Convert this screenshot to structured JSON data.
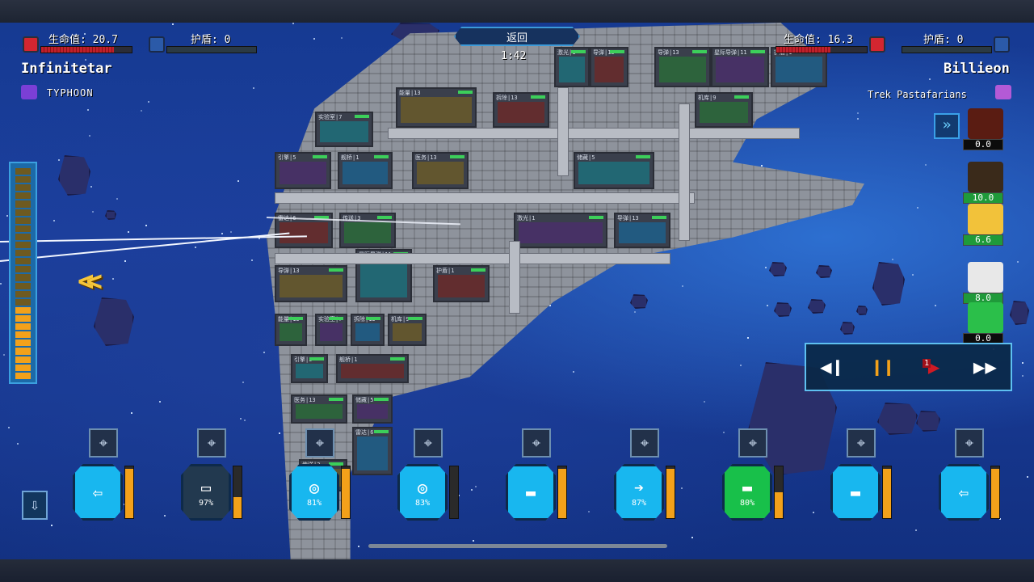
{
  "player": {
    "hp_label": "生命值: 20.7",
    "shield_label": "护盾: 0",
    "ship_name": "Infinitetar",
    "faction": "TYPHOON",
    "hp_fraction": 0.8
  },
  "enemy": {
    "hp_label": "生命值: 16.3",
    "shield_label": "护盾: 0",
    "ship_name": "Billieon",
    "faction": "Trek Pastafarians",
    "hp_fraction": 0.6
  },
  "header": {
    "back_label": "返回",
    "timer": "1:42"
  },
  "power": {
    "total_cells": 26,
    "active_cells": 9
  },
  "crew": [
    {
      "hp": "0.0",
      "style": "dark",
      "color": "#5a1c12"
    },
    {
      "hp": "10.0",
      "style": "green",
      "color": "#3a2a1a"
    },
    {
      "hp": "6.6",
      "style": "green",
      "color": "#f2c23a"
    },
    {
      "hp": "8.0",
      "style": "green",
      "color": "#e8e8e8"
    },
    {
      "hp": "0.0",
      "style": "dark",
      "color": "#2bbf4a"
    }
  ],
  "speed_controls": {
    "rewind_icon": "rewind-icon",
    "pause_icon": "pause-icon",
    "speed_badge": "1",
    "fastforward_icon": "fast-forward-icon"
  },
  "modules": [
    {
      "style": "blue",
      "glyph": "⇦",
      "pct": "",
      "gauge": 0.95
    },
    {
      "style": "dark",
      "glyph": "▭",
      "pct": "97%",
      "gauge": 0.4
    },
    {
      "style": "blue",
      "glyph": "◎",
      "pct": "81%",
      "gauge": 0.95
    },
    {
      "style": "blue",
      "glyph": "◎",
      "pct": "83%",
      "gauge": 0.0
    },
    {
      "style": "blue",
      "glyph": "▬",
      "pct": "",
      "gauge": 0.95
    },
    {
      "style": "blue",
      "glyph": "➔",
      "pct": "87%",
      "gauge": 0.95
    },
    {
      "style": "green",
      "glyph": "▬",
      "pct": "80%",
      "gauge": 0.5
    },
    {
      "style": "blue",
      "glyph": "▬",
      "pct": "",
      "gauge": 0.95
    },
    {
      "style": "blue",
      "glyph": "⇦",
      "pct": "",
      "gauge": 0.95
    }
  ],
  "rooms": [
    {
      "label": "激光|1"
    },
    {
      "label": "导弹|13"
    },
    {
      "label": "导弹|13"
    },
    {
      "label": "星际导弹|11"
    },
    {
      "label": "护盾|1"
    },
    {
      "label": "能量|13"
    },
    {
      "label": "实验室|7"
    },
    {
      "label": "拆除|13"
    },
    {
      "label": "机库|9"
    },
    {
      "label": "引擎|5"
    },
    {
      "label": "舰桥|1"
    },
    {
      "label": "医务|13"
    },
    {
      "label": "储藏|5"
    },
    {
      "label": "雷达|6"
    },
    {
      "label": "传送|3"
    }
  ]
}
